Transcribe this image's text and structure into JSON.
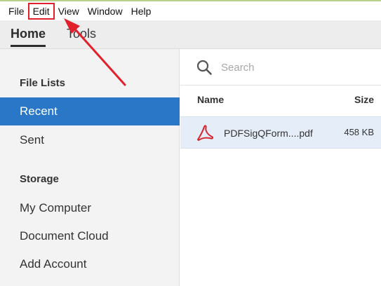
{
  "menubar": {
    "items": [
      {
        "label": "File"
      },
      {
        "label": "Edit"
      },
      {
        "label": "View"
      },
      {
        "label": "Window"
      },
      {
        "label": "Help"
      }
    ]
  },
  "tabs": {
    "home": "Home",
    "tools": "Tools"
  },
  "sidebar": {
    "file_lists_heading": "File Lists",
    "recent": "Recent",
    "sent": "Sent",
    "storage_heading": "Storage",
    "my_computer": "My Computer",
    "document_cloud": "Document Cloud",
    "add_account": "Add Account"
  },
  "search": {
    "placeholder": "Search"
  },
  "file_table": {
    "headers": {
      "name": "Name",
      "size": "Size"
    },
    "rows": [
      {
        "name": "PDFSigQForm....pdf",
        "size": "458 KB"
      }
    ]
  },
  "colors": {
    "accent": "#2a77c8",
    "annotation": "#e2202b",
    "pdf_icon": "#d7262f"
  },
  "icons": {
    "search": "search-icon",
    "file": "pdf-file-icon"
  }
}
